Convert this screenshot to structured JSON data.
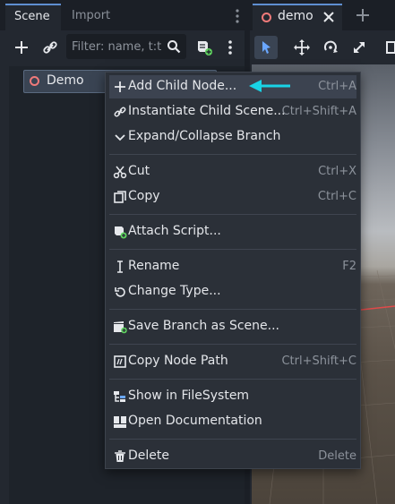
{
  "dock": {
    "tabs": [
      "Scene",
      "Import"
    ],
    "filter_placeholder": "Filter: name, t:t"
  },
  "tree": {
    "root_node": "Demo"
  },
  "viewport": {
    "tab_label": "demo"
  },
  "context_menu": {
    "items": [
      {
        "label": "Add Child Node...",
        "shortcut": "Ctrl+A"
      },
      {
        "label": "Instantiate Child Scene...",
        "shortcut": "Ctrl+Shift+A"
      },
      {
        "label": "Expand/Collapse Branch",
        "shortcut": ""
      },
      {
        "label": "Cut",
        "shortcut": "Ctrl+X"
      },
      {
        "label": "Copy",
        "shortcut": "Ctrl+C"
      },
      {
        "label": "Attach Script...",
        "shortcut": ""
      },
      {
        "label": "Rename",
        "shortcut": "F2"
      },
      {
        "label": "Change Type...",
        "shortcut": ""
      },
      {
        "label": "Save Branch as Scene...",
        "shortcut": ""
      },
      {
        "label": "Copy Node Path",
        "shortcut": "Ctrl+Shift+C"
      },
      {
        "label": "Show in FileSystem",
        "shortcut": ""
      },
      {
        "label": "Open Documentation",
        "shortcut": ""
      },
      {
        "label": "Delete",
        "shortcut": "Delete"
      }
    ]
  },
  "colors": {
    "accent": "#5f8fd1",
    "node_icon": "#f07a7a",
    "arrow": "#19d3e6"
  }
}
